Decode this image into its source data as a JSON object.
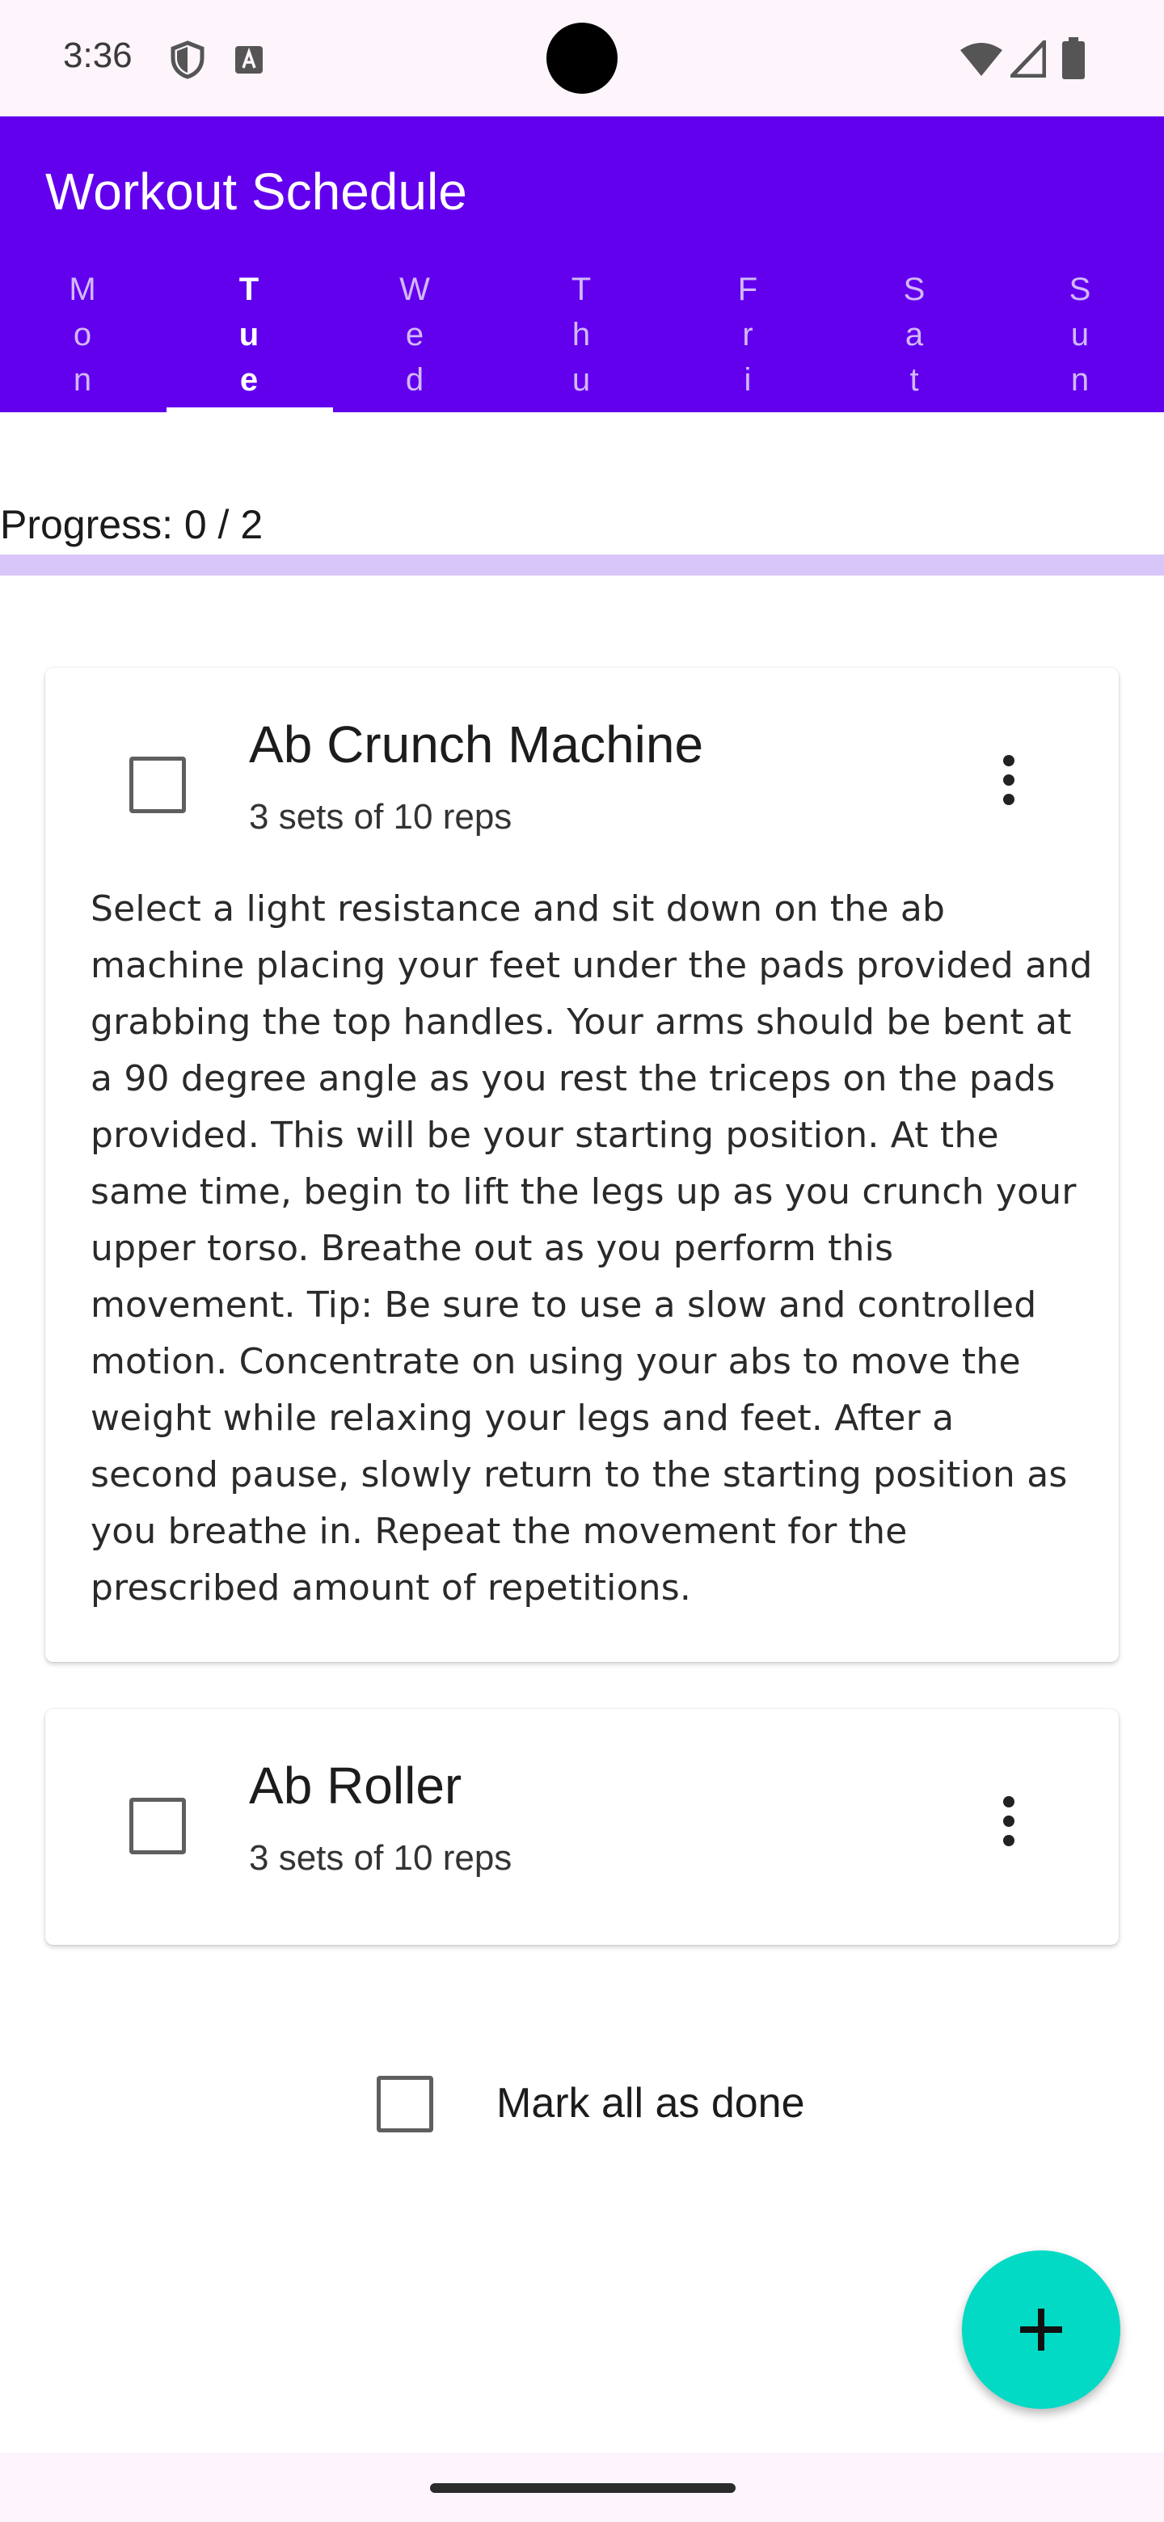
{
  "status_bar": {
    "time": "3:36",
    "icons": [
      "shield-icon",
      "font-a-icon",
      "wifi-icon",
      "signal-icon",
      "battery-icon"
    ]
  },
  "app_bar": {
    "title": "Workout Schedule",
    "color": "#6200ee",
    "tabs": [
      {
        "letters": [
          "M",
          "o",
          "n"
        ],
        "active": false
      },
      {
        "letters": [
          "T",
          "u",
          "e"
        ],
        "active": true
      },
      {
        "letters": [
          "W",
          "e",
          "d"
        ],
        "active": false
      },
      {
        "letters": [
          "T",
          "h",
          "u"
        ],
        "active": false
      },
      {
        "letters": [
          "F",
          "r",
          "i"
        ],
        "active": false
      },
      {
        "letters": [
          "S",
          "a",
          "t"
        ],
        "active": false
      },
      {
        "letters": [
          "S",
          "u",
          "n"
        ],
        "active": false
      }
    ]
  },
  "progress": {
    "label": "Progress: 0 / 2",
    "done": 0,
    "total": 2,
    "track_color": "#d7c6f7"
  },
  "exercises": [
    {
      "title": "Ab Crunch Machine",
      "subtitle": "3 sets of 10 reps",
      "checked": false,
      "description": "Select a light resistance and sit down on the ab machine placing your feet under the pads provided and grabbing the top handles. Your arms should be bent at a 90 degree angle as you rest the triceps on the pads provided. This will be your starting position. At the same time, begin to lift the legs up as you crunch your upper torso. Breathe out as you perform this movement. Tip: Be sure to use a slow and controlled motion. Concentrate on using your abs to move the weight while relaxing your legs and feet. After a second pause, slowly return to the starting position as you breathe in. Repeat the movement for the prescribed amount of repetitions."
    },
    {
      "title": "Ab Roller",
      "subtitle": "3 sets of 10 reps",
      "checked": false
    }
  ],
  "mark_all": {
    "label": "Mark all as done",
    "checked": false
  },
  "fab": {
    "icon": "plus-icon",
    "color": "#03dac5"
  }
}
